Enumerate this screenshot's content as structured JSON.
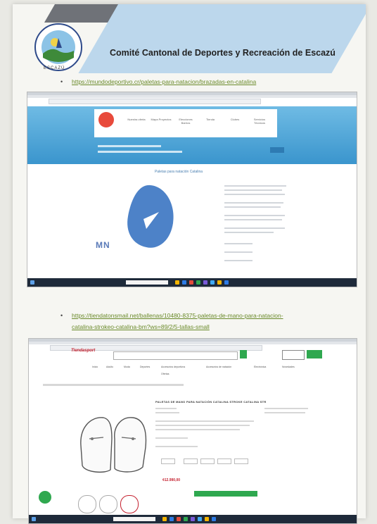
{
  "header": {
    "title": "Comité Cantonal de Deportes y Recreación de Escazú",
    "logo_caption": "ESCAZÚ"
  },
  "links": {
    "link1": "https://mundodeportivo.cr/paletas-para-natacion/brazadas-en-catalina",
    "link2_line1": "https://tiendatonsmail.net/ballenas/10480-8375-paletas-de-mano-para-natacion-",
    "link2_line2": "catalina-strokeo-catalina-bm?ws=89/2/5-tallas-small"
  },
  "shot1": {
    "nav_items": [
      "Nuestra oferta",
      "Mapa Proyectos",
      "Elecciones Barrios",
      "Tienda",
      "Clubes",
      "Servicios Técnicos"
    ],
    "brand_mark": "MN",
    "panel_heading": "Paletas para natación Catalina"
  },
  "shot2": {
    "logo_text": "Tiendasport",
    "menu_items": [
      "Inicio",
      "Adulto",
      "Moda",
      "Deportes",
      "Accesorios deportivos",
      "Accesorios de natación",
      "Electrónica",
      "Novedades",
      "Ofertas"
    ],
    "product_title": "PALETAS DE MANO PARA NATACIÓN CATALINA STROKE CATALINA STR",
    "price": "¢12.990,00"
  },
  "colors": {
    "band_light": "#bcd7ec",
    "band_dark": "#6f7278",
    "link_green": "#6a8a2a",
    "hero_blue": "#4fa7d8"
  }
}
